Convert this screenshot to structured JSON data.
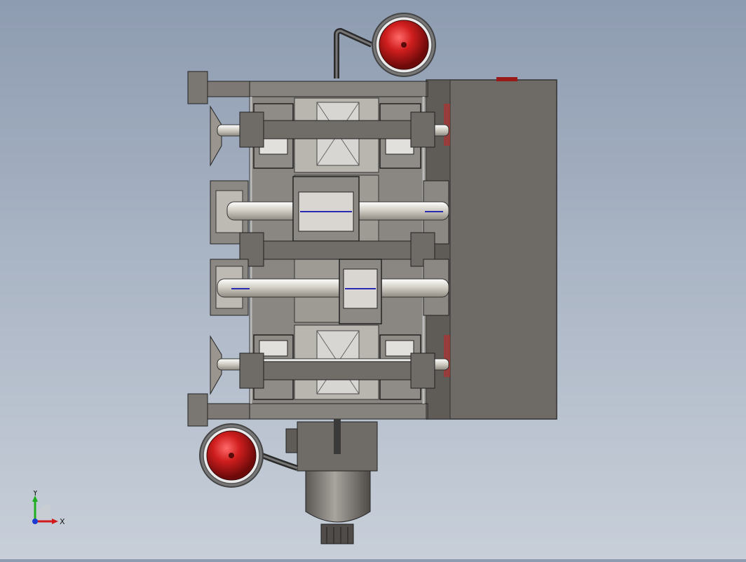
{
  "viewport": {
    "background_top": "#8e9cb1",
    "background_bottom": "#c8cfd9",
    "model_colors": {
      "housing": "#6f6b66",
      "housing_dark": "#4d4a47",
      "frame_bar": "#7d7873",
      "shaft": "#dedbd2",
      "red_accent": "#c41f1f",
      "blue_line": "#2a2ab0"
    }
  },
  "triad": {
    "x_label": "X",
    "y_label": "Y",
    "x_color": "#d11b1b",
    "y_color": "#1fae1f",
    "z_color": "#1b3bd1"
  }
}
